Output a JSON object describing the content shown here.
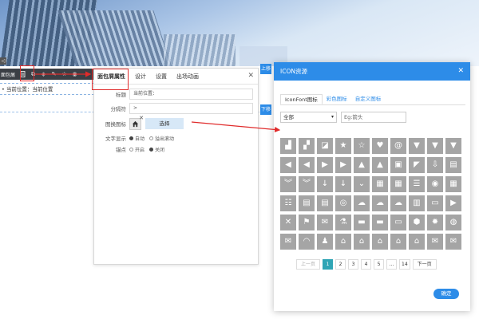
{
  "page": {
    "tiny_tab": "◁",
    "toolbar_label": "面包屑",
    "toolbar_icons": [
      "doc-edit-icon",
      "copy-icon",
      "layers-icon",
      "tool-icon",
      "star-icon",
      "eye-icon"
    ],
    "crumb_bullet": "•",
    "crumb_text": "当前位置：当前位置",
    "side_button_top": "上移",
    "side_button_mid": "下移"
  },
  "prop_panel": {
    "tabs": [
      "面包屑属性",
      "设计",
      "设置",
      "出场动画"
    ],
    "close": "✕",
    "title_label": "标题",
    "title_value": "当前位置：",
    "separator_label": "分隔符",
    "separator_value": ">",
    "icon_label": "图换图标",
    "icon_remove": "✕",
    "choose_label": "选择",
    "text_display_label": "文字显示",
    "text_display_options": [
      "自动",
      "溢出滚动"
    ],
    "anchor_label": "锚点",
    "anchor_options": [
      "开启",
      "关闭"
    ]
  },
  "icon_dialog": {
    "title": "ICON资源",
    "close": "✕",
    "tabs": [
      "IconFont图标",
      "彩色图标",
      "自定义图标"
    ],
    "category_value": "全部",
    "search_placeholder": "Eg:箭头",
    "pager": {
      "prev": "上一页",
      "pages": [
        "1",
        "2",
        "3",
        "4",
        "5",
        "…",
        "14"
      ],
      "next": "下一页",
      "current": "1"
    },
    "ok": "确定",
    "icons": [
      [
        "signal-bars-icon",
        "▟"
      ],
      [
        "rising-chart-icon",
        "▞"
      ],
      [
        "growth-chart-icon",
        "◪"
      ],
      [
        "star-edit-icon",
        "★"
      ],
      [
        "star-outline-icon",
        "☆"
      ],
      [
        "heart-icon",
        "♥"
      ],
      [
        "at-sign-icon",
        "@"
      ],
      [
        "arrow-down-tri-icon",
        "▼"
      ],
      [
        "arrow-down-tri-icon",
        "▼"
      ],
      [
        "spacer",
        "▼"
      ],
      [
        "arrow-left-tri-icon",
        "◀"
      ],
      [
        "arrow-left-tri-icon",
        "◀"
      ],
      [
        "arrow-right-tri-icon",
        "▶"
      ],
      [
        "arrow-right-icon",
        "▶"
      ],
      [
        "arrow-up-icon",
        "▲"
      ],
      [
        "arrow-up-icon",
        "▲"
      ],
      [
        "briefcase-icon",
        "▣"
      ],
      [
        "megaphone-icon",
        "◤"
      ],
      [
        "arrow-down-box-icon",
        "⇩"
      ],
      [
        "spacer",
        "▤"
      ],
      [
        "double-chevron-down-icon",
        "︾"
      ],
      [
        "double-chevron-down-icon",
        "︾"
      ],
      [
        "arrow-down-icon",
        "↓"
      ],
      [
        "arrow-down-icon",
        "↓"
      ],
      [
        "chevron-down-icon",
        "⌄"
      ],
      [
        "calendar-icon",
        "▦"
      ],
      [
        "calendar-icon",
        "▦"
      ],
      [
        "list-icon",
        "☰"
      ],
      [
        "chat-icon",
        "◉"
      ],
      [
        "calendar-grid-icon",
        "▦"
      ],
      [
        "list-detail-icon",
        "☷"
      ],
      [
        "id-card-icon",
        "▤"
      ],
      [
        "id-card-icon",
        "▤"
      ],
      [
        "badge-icon",
        "◎"
      ],
      [
        "cloud-icon",
        "☁"
      ],
      [
        "cloud-upload-icon",
        "☁"
      ],
      [
        "cloud-outline-icon",
        "☁"
      ],
      [
        "chart-icon",
        "▥"
      ],
      [
        "monitor-icon",
        "▭"
      ],
      [
        "play-screen-icon",
        "▶"
      ],
      [
        "close-box-icon",
        "✕"
      ],
      [
        "flag-icon",
        "⚑"
      ],
      [
        "pin-icon",
        "✉"
      ],
      [
        "flask-icon",
        "⚗"
      ],
      [
        "folder-icon",
        "▬"
      ],
      [
        "card-icon",
        "▬"
      ],
      [
        "hdd-icon",
        "▭"
      ],
      [
        "box-icon",
        "⬢"
      ],
      [
        "gear-icon",
        "✹"
      ],
      [
        "globe-icon",
        "◍"
      ],
      [
        "inbox-icon",
        "✉"
      ],
      [
        "headphones-icon",
        "◠"
      ],
      [
        "user-pin-icon",
        "♟"
      ],
      [
        "home-icon",
        "⌂"
      ],
      [
        "home-icon",
        "⌂"
      ],
      [
        "home-outline-icon",
        "⌂"
      ],
      [
        "home-add-icon",
        "⌂"
      ],
      [
        "home-star-icon",
        "⌂"
      ],
      [
        "mail-open-icon",
        "✉"
      ],
      [
        "spacer",
        "✉"
      ]
    ]
  }
}
